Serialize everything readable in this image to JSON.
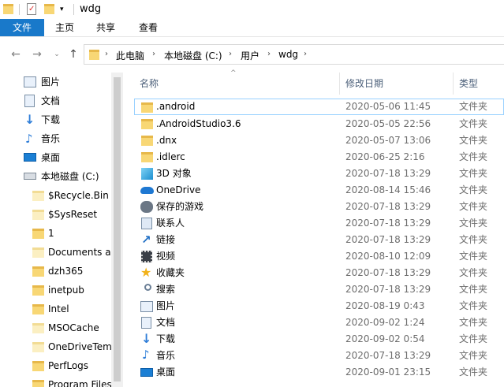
{
  "window": {
    "title": "wdg"
  },
  "ribbon": {
    "tabs": [
      "文件",
      "主页",
      "共享",
      "查看"
    ]
  },
  "address": {
    "crumbs": [
      "此电脑",
      "本地磁盘 (C:)",
      "用户",
      "wdg"
    ]
  },
  "nav": {
    "items": [
      {
        "label": "图片",
        "icon": "pictures-icon",
        "level": 1
      },
      {
        "label": "文档",
        "icon": "documents-icon",
        "level": 1
      },
      {
        "label": "下载",
        "icon": "download-icon",
        "level": 1
      },
      {
        "label": "音乐",
        "icon": "music-icon",
        "level": 1
      },
      {
        "label": "桌面",
        "icon": "desktop-icon",
        "level": 1
      },
      {
        "label": "本地磁盘 (C:)",
        "icon": "drive-icon",
        "level": 1
      },
      {
        "label": "$Recycle.Bin",
        "icon": "folder-icon",
        "level": 2
      },
      {
        "label": "$SysReset",
        "icon": "folder-icon",
        "level": 2
      },
      {
        "label": "1",
        "icon": "folder-icon",
        "level": 2
      },
      {
        "label": "Documents and Settings",
        "icon": "shortcut-folder-icon",
        "level": 2
      },
      {
        "label": "dzh365",
        "icon": "folder-icon",
        "level": 2
      },
      {
        "label": "inetpub",
        "icon": "folder-icon",
        "level": 2
      },
      {
        "label": "Intel",
        "icon": "folder-icon",
        "level": 2
      },
      {
        "label": "MSOCache",
        "icon": "folder-icon",
        "level": 2
      },
      {
        "label": "OneDriveTemp",
        "icon": "folder-icon",
        "level": 2
      },
      {
        "label": "PerfLogs",
        "icon": "folder-icon",
        "level": 2
      },
      {
        "label": "Program Files",
        "icon": "folder-icon",
        "level": 2
      }
    ]
  },
  "columns": {
    "name": "名称",
    "date": "修改日期",
    "type": "类型"
  },
  "files": [
    {
      "name": ".android",
      "date": "2020-05-06 11:45",
      "type": "文件夹",
      "icon": "folder-icon"
    },
    {
      "name": ".AndroidStudio3.6",
      "date": "2020-05-05 22:56",
      "type": "文件夹",
      "icon": "folder-icon"
    },
    {
      "name": ".dnx",
      "date": "2020-05-07 13:06",
      "type": "文件夹",
      "icon": "folder-icon"
    },
    {
      "name": ".idlerc",
      "date": "2020-06-25 2:16",
      "type": "文件夹",
      "icon": "folder-icon"
    },
    {
      "name": "3D 对象",
      "date": "2020-07-18 13:29",
      "type": "文件夹",
      "icon": "3d-objects-icon"
    },
    {
      "name": "OneDrive",
      "date": "2020-08-14 15:46",
      "type": "文件夹",
      "icon": "onedrive-icon"
    },
    {
      "name": "保存的游戏",
      "date": "2020-07-18 13:29",
      "type": "文件夹",
      "icon": "saved-games-icon"
    },
    {
      "name": "联系人",
      "date": "2020-07-18 13:29",
      "type": "文件夹",
      "icon": "contacts-icon"
    },
    {
      "name": "链接",
      "date": "2020-07-18 13:29",
      "type": "文件夹",
      "icon": "links-icon"
    },
    {
      "name": "视频",
      "date": "2020-08-10 12:09",
      "type": "文件夹",
      "icon": "videos-icon"
    },
    {
      "name": "收藏夹",
      "date": "2020-07-18 13:29",
      "type": "文件夹",
      "icon": "favorites-icon"
    },
    {
      "name": "搜索",
      "date": "2020-07-18 13:29",
      "type": "文件夹",
      "icon": "searches-icon"
    },
    {
      "name": "图片",
      "date": "2020-08-19 0:43",
      "type": "文件夹",
      "icon": "pictures-icon"
    },
    {
      "name": "文档",
      "date": "2020-09-02 1:24",
      "type": "文件夹",
      "icon": "documents-icon"
    },
    {
      "name": "下载",
      "date": "2020-09-02 0:54",
      "type": "文件夹",
      "icon": "download-icon"
    },
    {
      "name": "音乐",
      "date": "2020-07-18 13:29",
      "type": "文件夹",
      "icon": "music-icon"
    },
    {
      "name": "桌面",
      "date": "2020-09-01 23:15",
      "type": "文件夹",
      "icon": "desktop-icon"
    }
  ],
  "colors": {
    "accent": "#1979ca",
    "folder": "#f8d775",
    "selection": "#99d1ff"
  }
}
